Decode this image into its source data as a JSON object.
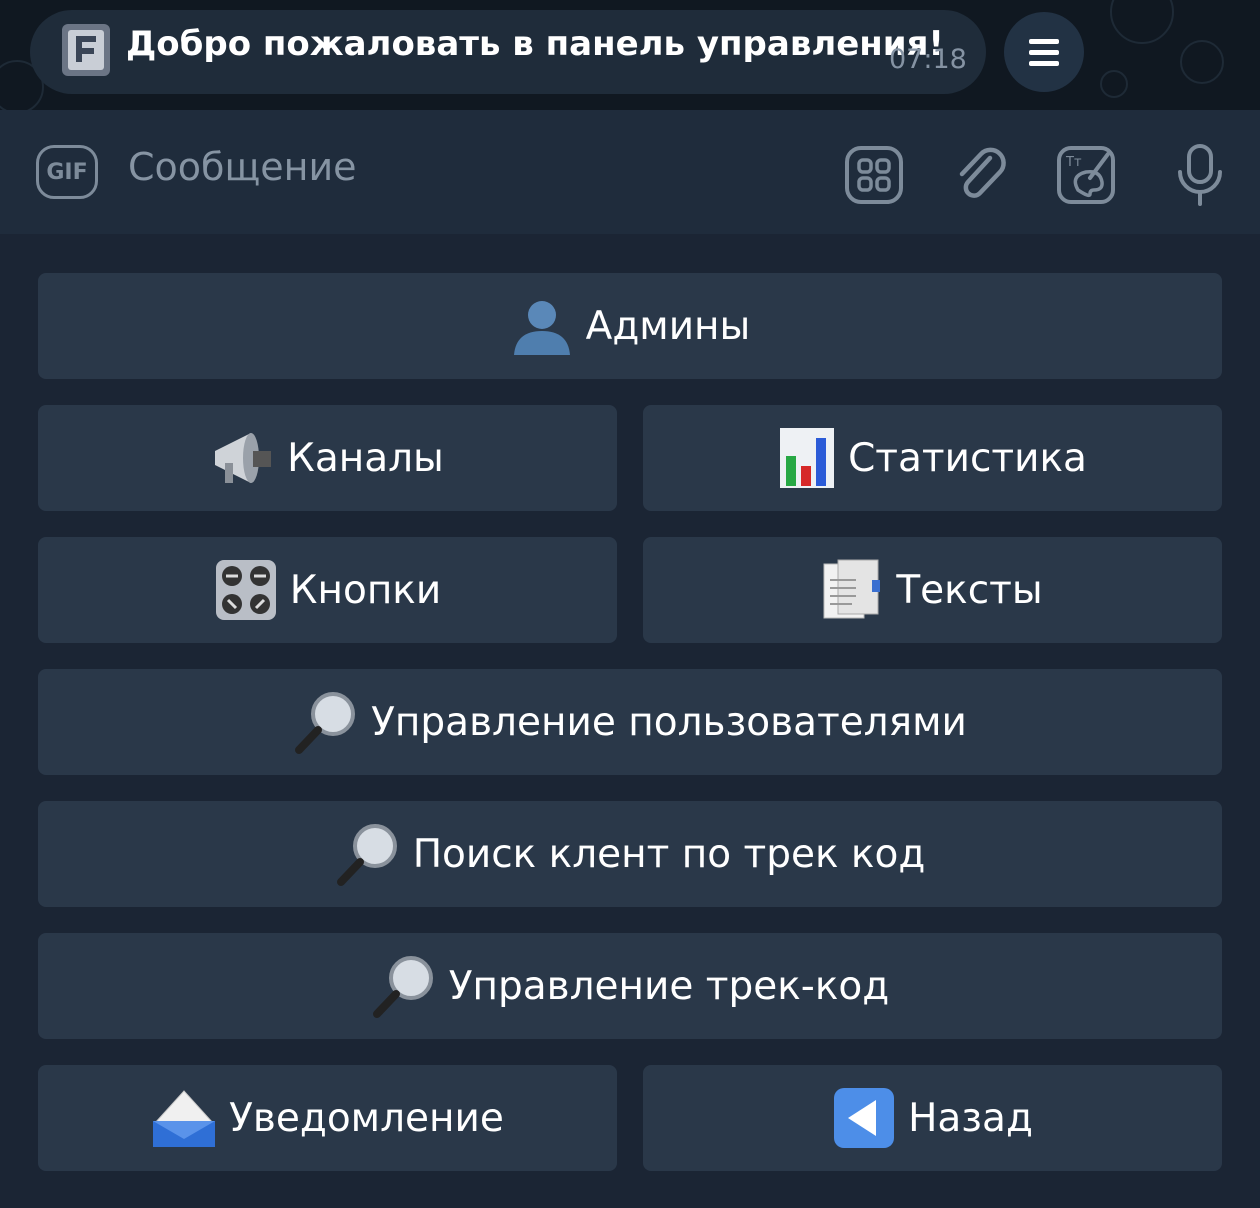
{
  "chat": {
    "message_text": "Добро пожаловать в панель управления!",
    "message_time": "07:18"
  },
  "composer": {
    "gif_label": "GIF",
    "placeholder": "Сообщение"
  },
  "keyboard": {
    "admins": "Админы",
    "channels": "Каналы",
    "statistics": "Статистика",
    "buttons": "Кнопки",
    "texts": "Тексты",
    "user_management": "Управление пользователями",
    "search_client": "Поиск клент по трек код",
    "track_management": "Управление трек-код",
    "notification": "Уведомление",
    "back": "Назад"
  },
  "colors": {
    "background": "#1b2534",
    "button": "#2a3849",
    "input_bar": "#1f2c3c",
    "icon_gray": "#7d8b9a"
  }
}
